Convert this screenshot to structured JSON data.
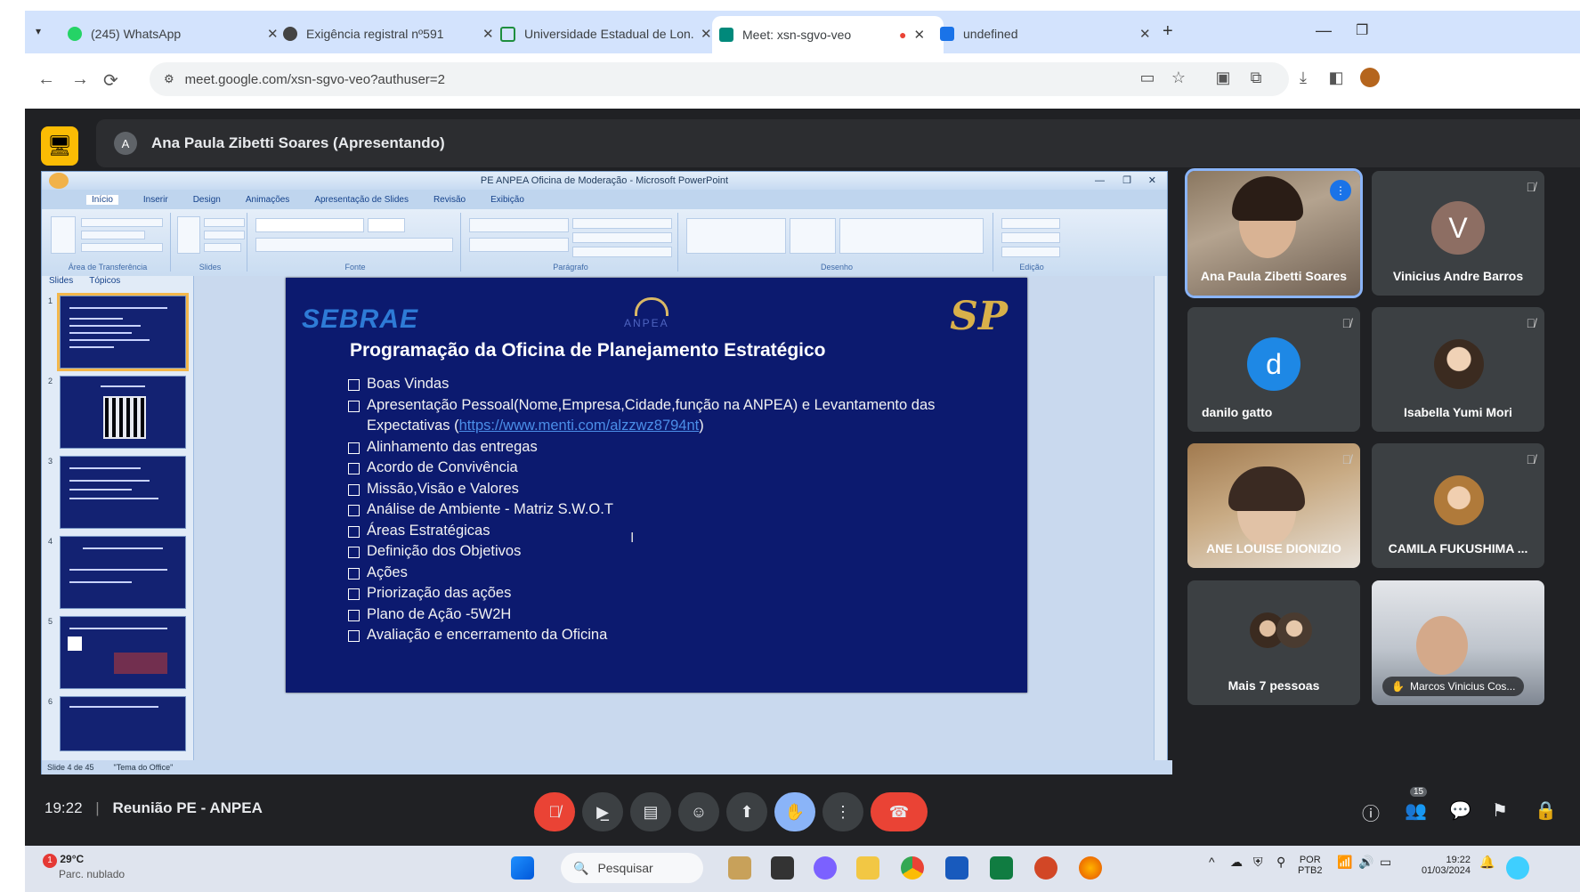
{
  "browser": {
    "tabs": [
      {
        "title": "(245) WhatsApp",
        "color": "#25d366"
      },
      {
        "title": "Exigência registral nº591",
        "color": "#444444"
      },
      {
        "title": "Universidade Estadual de Lon...",
        "color": "#1e8e3e"
      },
      {
        "title": "Meet: xsn-sgvo-veo",
        "color": "#00897b"
      },
      {
        "title": "undefined",
        "color": "#1a73e8"
      }
    ],
    "new_tab_glyph": "+",
    "url": "meet.google.com/xsn-sgvo-veo?authuser=2"
  },
  "meet": {
    "presenter_label": "Ana Paula Zibetti Soares (Apresentando)",
    "meeting_time": "19:22",
    "meeting_name": "Reunião PE - ANPEA",
    "accent": "#fbbc04"
  },
  "powerpoint": {
    "window_title": "PE ANPEA Oficina de Moderação - Microsoft PowerPoint",
    "ribbon_tabs": [
      "Início",
      "Inserir",
      "Design",
      "Animações",
      "Apresentação de Slides",
      "Revisão",
      "Exibição"
    ],
    "ribbon_groups": [
      "Área de Transferência",
      "Slides",
      "Fonte",
      "Parágrafo",
      "Desenho",
      "Edição"
    ],
    "panel_tabs": [
      "Slides",
      "Tópicos"
    ],
    "status_left": "Slide 4 de 45",
    "status_theme": "\"Tema do Office\"",
    "thumb_numbers": [
      "1",
      "2",
      "3",
      "4",
      "5",
      "6"
    ]
  },
  "slide": {
    "logo_left": "SEBRAE",
    "logo_center": "ANPEA",
    "logo_right": "SP",
    "title": "Programação da Oficina de Planejamento Estratégico",
    "items": [
      "Boas Vindas",
      "Apresentação Pessoal(Nome,Empresa,Cidade,função na ANPEA) e Levantamento das",
      "Alinhamento das entregas",
      "Acordo de Convivência",
      "Missão,Visão e Valores",
      "Análise de Ambiente  - Matriz  S.W.O.T",
      "Áreas Estratégicas",
      "Definição dos Objetivos",
      "Ações",
      "Priorização das ações",
      "Plano de Ação -5W2H",
      "Avaliação e encerramento da Oficina"
    ],
    "expectativas_prefix": "Expectativas (",
    "expectativas_link": "https://www.menti.com/alzzwz8794nt",
    "expectativas_suffix": ")"
  },
  "participants": [
    {
      "name": "Ana Paula Zibetti Soares",
      "type": "video"
    },
    {
      "name": "Vinicius Andre Barros",
      "initial": "V",
      "color": "#8d6e63"
    },
    {
      "name": "danilo gatto",
      "initial": "d",
      "color": "#1e88e5"
    },
    {
      "name": "Isabella Yumi Mori",
      "type": "photo"
    },
    {
      "name": "ANE LOUISE DIONIZIO",
      "type": "video"
    },
    {
      "name": "CAMILA FUKUSHIMA ...",
      "type": "photo"
    },
    {
      "name": "Mais 7 pessoas",
      "type": "group"
    },
    {
      "name": "Marcos Vinicius Cos...",
      "type": "video"
    }
  ],
  "controls": {
    "participant_badge": "15"
  },
  "taskbar": {
    "temperature": "29°C",
    "weather_text": "Parc. nublado",
    "weather_badge": "1",
    "search_placeholder": "Pesquisar",
    "lang_top": "POR",
    "lang_bottom": "PTB2",
    "clock_time": "19:22",
    "clock_date": "01/03/2024"
  }
}
